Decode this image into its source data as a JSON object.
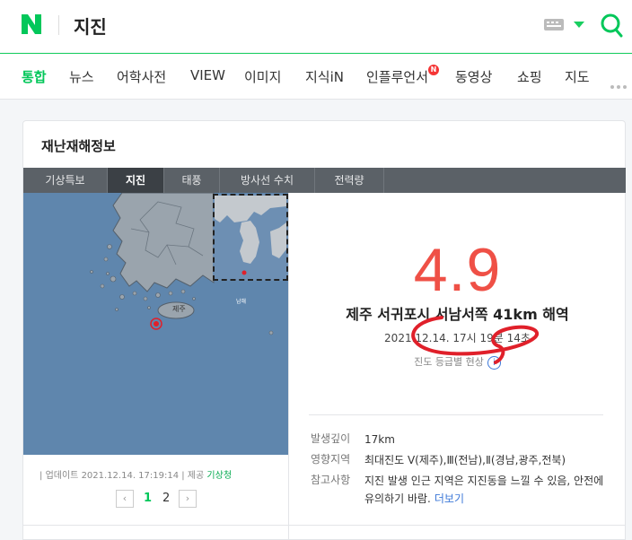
{
  "header": {
    "query": "지진",
    "logo_letter": "N"
  },
  "nav": {
    "items": [
      "통합",
      "뉴스",
      "어학사전",
      "VIEW",
      "이미지",
      "지식iN",
      "인플루언서",
      "동영상",
      "쇼핑",
      "지도"
    ],
    "active": "통합",
    "badge": "N"
  },
  "card": {
    "title": "재난재해정보",
    "tabs": [
      "기상특보",
      "지진",
      "태풍",
      "방사선 수치",
      "전력량"
    ],
    "active_tab": "지진"
  },
  "map": {
    "place_label_jeju": "제주",
    "place_label_small": "남해"
  },
  "quake": {
    "magnitude": "4.9",
    "location": "제주 서귀포시 서남서쪽 41km 해역",
    "datetime": "2021.12.14. 17시 19분 14초",
    "intensity_label": "진도 등급별 현상",
    "info_icon_glyph": "i"
  },
  "details": {
    "depth_label": "발생깊이",
    "depth_value": "17km",
    "region_label": "영향지역",
    "region_value": "최대진도 Ⅴ(제주),Ⅲ(전남),Ⅱ(경남,광주,전북)",
    "note_label": "참고사항",
    "note_value": "지진 발생 인근 지역은 지진동을 느낄 수 있음, 안전에 유의하기 바람.",
    "more_link": "더보기"
  },
  "update": {
    "prefix": "업데이트",
    "timestamp": "2021.12.14. 17:19:14",
    "provider_label": "제공",
    "provider": "기상청"
  },
  "pager": {
    "prev": "‹",
    "next": "›",
    "pages": [
      "1",
      "2"
    ],
    "current": "1"
  },
  "colors": {
    "brand": "#03c75a",
    "magnitude": "#ef5046",
    "link": "#3d78d8",
    "annotation": "#e0202a"
  }
}
